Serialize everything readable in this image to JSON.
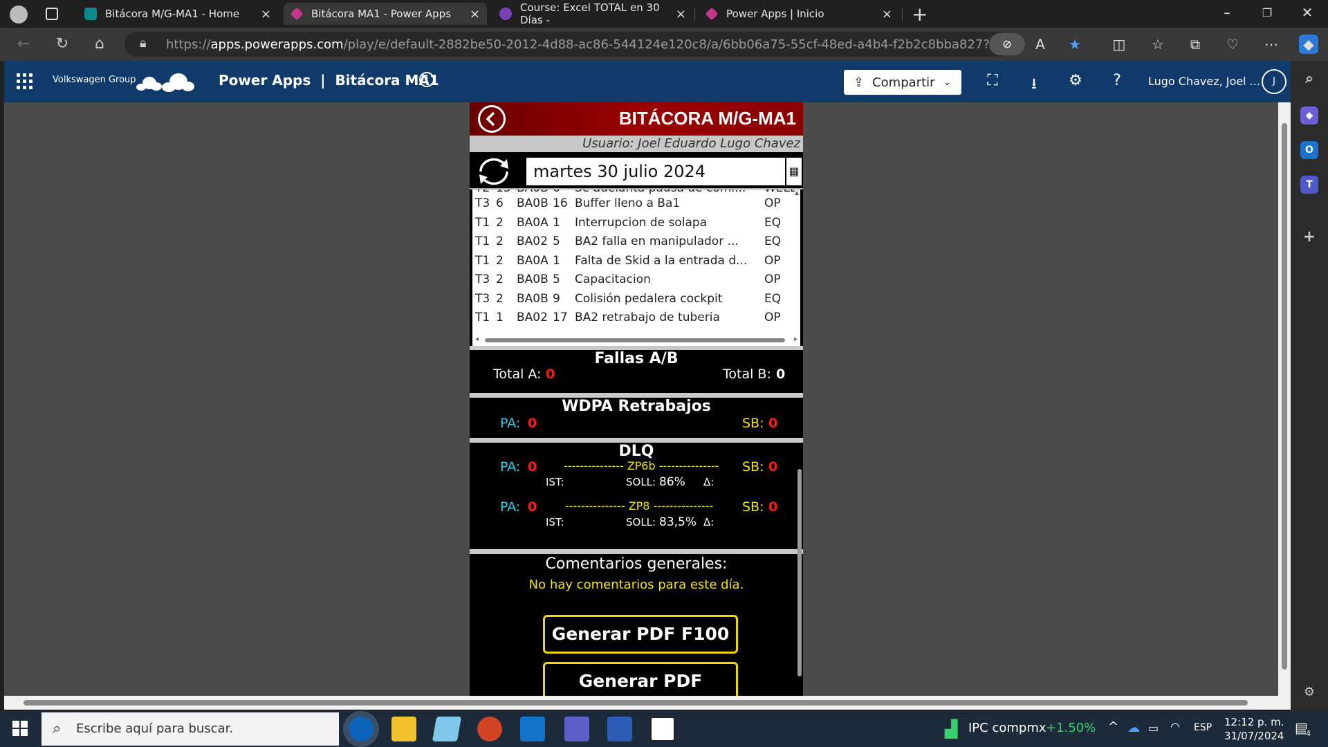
{
  "browser": {
    "tabs": [
      {
        "title": "Bitácora M/G-MA1 - Home",
        "icon_color": "#0a8a8a"
      },
      {
        "title": "Bitácora MA1 - Power Apps",
        "icon_color": "#c2378f"
      },
      {
        "title": "Course: Excel TOTAL en 30 Días -",
        "icon_color": "#7b3fb5"
      },
      {
        "title": "Power Apps | Inicio",
        "icon_color": "#c2378f"
      }
    ],
    "url_host": "apps.powerapps.com",
    "url_prefix": "https://",
    "url_rest": "/play/e/default-2882be50-2012-4d88-ac86-544124e120c8/a/6bb06a75-55cf-48ed-a4b4-f2b2c8bba827?tenantId=2882be5..."
  },
  "powerapps": {
    "org": "Volkswagen Group",
    "title": "Power Apps  |  Bitácora MA1",
    "share_label": "Compartir",
    "user_name": "Lugo Chavez, Joel ...",
    "avatar_initial": "J"
  },
  "app": {
    "title": "BITÁCORA M/G-MA1",
    "user_line": "Usuario: Joel Eduardo Lugo Chavez",
    "date": "martes 30 julio 2024",
    "rows_partial": [
      "T2",
      "15",
      "BA0B",
      "6",
      "Se adelanta pausa de comi...",
      "WELD"
    ],
    "rows": [
      [
        "T3",
        "6",
        "BA0B",
        "16",
        "Buffer lleno a Ba1",
        "OP"
      ],
      [
        "T1",
        "2",
        "BA0A",
        "1",
        "Interrupcion de solapa",
        "EQ"
      ],
      [
        "T1",
        "2",
        "BA02",
        "5",
        "BA2 falla en manipulador ...",
        "EQ"
      ],
      [
        "T1",
        "2",
        "BA0A",
        "1",
        "Falta de Skid a la entrada d...",
        "OP"
      ],
      [
        "T3",
        "2",
        "BA0B",
        "5",
        "Capacitacion",
        "OP"
      ],
      [
        "T3",
        "2",
        "BA0B",
        "9",
        "Colisión pedalera cockpit",
        "EQ"
      ],
      [
        "T1",
        "1",
        "BA02",
        "17",
        "BA2 retrabajo de tuberia",
        "OP"
      ]
    ],
    "fallas": {
      "title": "Fallas A/B",
      "total_a_label": "Total A:",
      "total_a": "0",
      "total_b_label": "Total B:",
      "total_b": "0"
    },
    "wdpa": {
      "title": "WDPA Retrabajos",
      "pa_label": "PA:",
      "pa": "0",
      "sb_label": "SB:",
      "sb": "0"
    },
    "dlq": {
      "title": "DLQ",
      "zp6b": {
        "pa_label": "PA:",
        "pa": "0",
        "name": "--------------- ZP6b ---------------",
        "sb_label": "SB:",
        "sb": "0",
        "ist": "IST:",
        "soll_label": "SOLL:",
        "soll": "86%",
        "delta": "Δ:"
      },
      "zp8": {
        "pa_label": "PA:",
        "pa": "0",
        "name": "--------------- ZP8 ---------------",
        "sb_label": "SB:",
        "sb": "0",
        "ist": "IST:",
        "soll_label": "SOLL:",
        "soll": "83,5%",
        "delta": "Δ:"
      }
    },
    "comments": {
      "title": "Comentarios generales:",
      "text": "No hay comentarios para este día."
    },
    "btn_f100": "Generar PDF F100",
    "btn_bitacora": "Generar PDF Bitácora"
  },
  "taskbar": {
    "search_placeholder": "Escribe aquí para buscar.",
    "ticker": "IPC compmx",
    "ticker_change": "+1.50%",
    "lang": "ESP",
    "time": "12:12 p. m.",
    "date": "31/07/2024",
    "notif_count": "4"
  }
}
